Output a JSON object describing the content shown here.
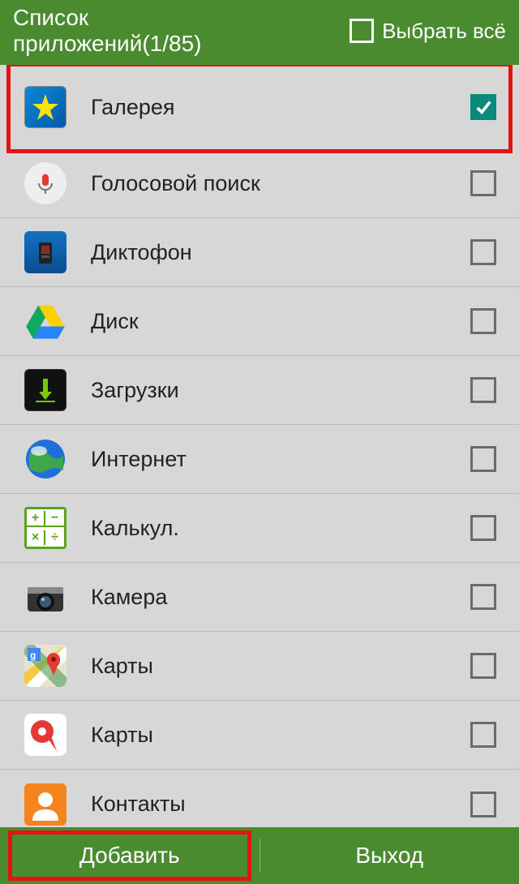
{
  "header": {
    "title_line1": "Список",
    "title_line2": "приложений(1/85)",
    "select_all_label": "Выбрать всё",
    "select_all_checked": false
  },
  "apps": [
    {
      "name": "Галерея",
      "icon": "gallery",
      "checked": true,
      "highlighted": true
    },
    {
      "name": "Голосовой поиск",
      "icon": "voice",
      "checked": false,
      "highlighted": false
    },
    {
      "name": "Диктофон",
      "icon": "recorder",
      "checked": false,
      "highlighted": false
    },
    {
      "name": "Диск",
      "icon": "drive",
      "checked": false,
      "highlighted": false
    },
    {
      "name": "Загрузки",
      "icon": "downloads",
      "checked": false,
      "highlighted": false
    },
    {
      "name": "Интернет",
      "icon": "internet",
      "checked": false,
      "highlighted": false
    },
    {
      "name": "Калькул.",
      "icon": "calc",
      "checked": false,
      "highlighted": false
    },
    {
      "name": "Камера",
      "icon": "camera",
      "checked": false,
      "highlighted": false
    },
    {
      "name": "Карты",
      "icon": "gmaps",
      "checked": false,
      "highlighted": false
    },
    {
      "name": "Карты",
      "icon": "ymaps",
      "checked": false,
      "highlighted": false
    },
    {
      "name": "Контакты",
      "icon": "contacts",
      "checked": false,
      "highlighted": false
    }
  ],
  "footer": {
    "add_label": "Добавить",
    "exit_label": "Выход",
    "add_highlighted": true
  }
}
